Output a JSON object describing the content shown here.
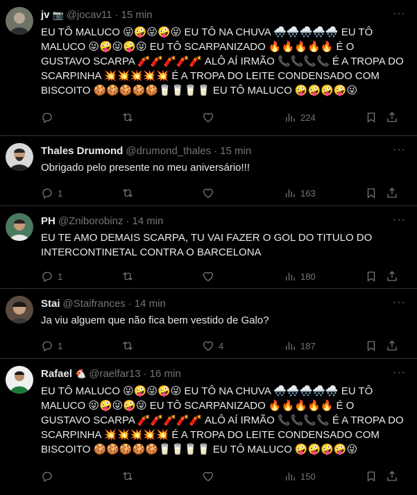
{
  "tweets": [
    {
      "name": "jv",
      "badge": "📷",
      "handle": "@jocav11",
      "time": "15 min",
      "body": "EU TÔ MALUCO 😜🤪😜🤪😜 EU TÔ NA CHUVA 🌨️🌨️🌨️🌨️🌨️ EU TÔ MALUCO 😜🤪😜🤪😜 EU TÔ SCARPANIZADO 🔥🔥🔥🔥🔥 É O GUSTAVO SCARPA 🧨🧨🧨🧨🧨 ALÔ AÍ IRMÃO 📞📞📞📞 É A TROPA DO SCARPINHA 💥💥💥💥💥 É A TROPA DO LEITE CONDENSADO COM BISCOITO 🍪🍪🍪🍪🍪🥛🥛🥛🥛 EU TÔ MALUCO 🤪🤪🤪🤪😜",
      "replies": "",
      "retweets": "",
      "likes": "",
      "views": "224",
      "avatar_color": "#8a8f7a"
    },
    {
      "name": "Thales Drumond",
      "badge": "",
      "handle": "@drumond_thales",
      "time": "15 min",
      "body": "Obrigado pelo presente no meu aniversário!!!",
      "replies": "1",
      "retweets": "",
      "likes": "",
      "views": "163",
      "avatar_color": "#5a4a3e"
    },
    {
      "name": "PH",
      "badge": "",
      "handle": "@Zniborobinz",
      "time": "14 min",
      "body": "EU TE AMO DEMAIS SCARPA, TU VAI FAZER O GOL DO TITULO DO INTERCONTINETAL CONTRA O BARCELONA",
      "replies": "1",
      "retweets": "",
      "likes": "",
      "views": "180",
      "avatar_color": "#3f6b54"
    },
    {
      "name": "Stai",
      "badge": "",
      "handle": "@Staifrances",
      "time": "14 min",
      "body": "Ja viu alguem que não fica bem vestido de Galo?",
      "replies": "1",
      "retweets": "",
      "likes": "4",
      "views": "187",
      "avatar_color": "#6a5748"
    },
    {
      "name": "Rafael",
      "badge": "🐔",
      "handle": "@raelfar13",
      "time": "16 min",
      "body": "EU TÔ MALUCO 😜🤪😜🤪😜 EU TÔ NA CHUVA 🌨️🌨️🌨️🌨️🌨️ EU TÔ MALUCO 😜🤪😜🤪😜 EU TÔ SCARPANIZADO 🔥🔥🔥🔥🔥 É O GUSTAVO SCARPA 🧨🧨🧨🧨🧨 ALÔ AÍ IRMÃO 📞📞📞📞 É A TROPA DO SCARPINHA 💥💥💥💥💥 É A TROPA DO LEITE CONDENSADO COM BISCOITO 🍪🍪🍪🍪🍪🥛🥛🥛🥛 EU TÔ MALUCO 🤪🤪🤪🤪😜",
      "replies": "",
      "retweets": "",
      "likes": "",
      "views": "150",
      "avatar_color": "#dfe6e3"
    }
  ],
  "icons": {
    "reply": "reply-icon",
    "retweet": "retweet-icon",
    "like": "like-icon",
    "views": "views-icon",
    "bookmark": "bookmark-icon",
    "share": "share-icon",
    "more": "more-icon"
  },
  "colors": {
    "background": "#000000",
    "text": "#e7e9ea",
    "secondary": "#71767b",
    "divider": "#2f3336"
  }
}
